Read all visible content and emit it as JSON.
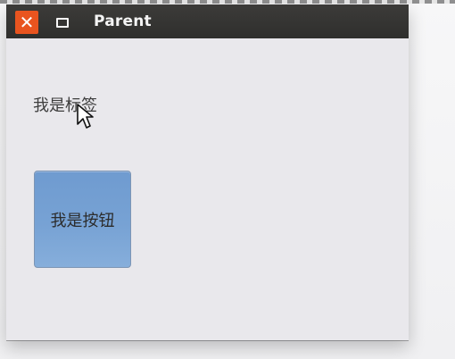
{
  "window": {
    "title": "Parent",
    "close_glyph": "✕",
    "maximize_icon": "maximize-icon",
    "close_icon": "close-icon"
  },
  "content": {
    "label_text": "我是标签",
    "button_text": "我是按钮"
  },
  "colors": {
    "titlebar": "#333331",
    "close_button": "#e9541f",
    "window_background": "#e9e8ec",
    "button_fill": "#77a2d4"
  }
}
